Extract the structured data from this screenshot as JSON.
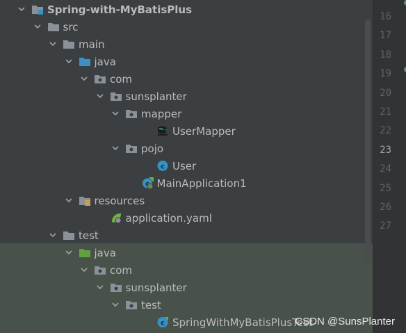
{
  "tree": [
    {
      "label": "Spring-with-MyBatisPlus",
      "depth": 0,
      "icon": "module-folder-icon",
      "expanded": true,
      "bold": true,
      "name": "project-root"
    },
    {
      "label": "src",
      "depth": 1,
      "icon": "folder-icon",
      "expanded": true,
      "name": "src-folder"
    },
    {
      "label": "main",
      "depth": 2,
      "icon": "folder-icon",
      "expanded": true,
      "name": "main-folder"
    },
    {
      "label": "java",
      "depth": 3,
      "icon": "source-root-folder-icon",
      "expanded": true,
      "name": "main-java-folder"
    },
    {
      "label": "com",
      "depth": 4,
      "icon": "package-icon",
      "expanded": true,
      "name": "com-package"
    },
    {
      "label": "sunsplanter",
      "depth": 5,
      "icon": "package-icon",
      "expanded": true,
      "name": "sunsplanter-package"
    },
    {
      "label": "mapper",
      "depth": 6,
      "icon": "package-icon",
      "expanded": true,
      "name": "mapper-package"
    },
    {
      "label": "UserMapper",
      "depth": 8,
      "icon": "mybatis-mapper-icon",
      "name": "usermapper-file"
    },
    {
      "label": "pojo",
      "depth": 6,
      "icon": "package-icon",
      "expanded": true,
      "name": "pojo-package"
    },
    {
      "label": "User",
      "depth": 8,
      "icon": "class-icon",
      "name": "user-class-file"
    },
    {
      "label": "MainApplication1",
      "depth": 7,
      "icon": "spring-boot-class-icon",
      "name": "mainapplication-file"
    },
    {
      "label": "resources",
      "depth": 3,
      "icon": "resources-folder-icon",
      "expanded": true,
      "name": "resources-folder"
    },
    {
      "label": "application.yaml",
      "depth": 5,
      "icon": "spring-config-icon",
      "name": "application-yaml-file"
    },
    {
      "label": "test",
      "depth": 2,
      "icon": "folder-icon",
      "expanded": true,
      "name": "test-folder"
    },
    {
      "label": "java",
      "depth": 3,
      "icon": "test-root-folder-icon",
      "expanded": true,
      "name": "test-java-folder"
    },
    {
      "label": "com",
      "depth": 4,
      "icon": "package-icon",
      "expanded": true,
      "name": "test-com-package"
    },
    {
      "label": "sunsplanter",
      "depth": 5,
      "icon": "package-icon",
      "expanded": true,
      "name": "test-sunsplanter-package"
    },
    {
      "label": "test",
      "depth": 6,
      "icon": "package-icon",
      "expanded": true,
      "name": "test-package"
    },
    {
      "label": "SpringWithMyBatisPlusTest",
      "depth": 8,
      "icon": "test-class-icon",
      "name": "test-class-file"
    }
  ],
  "gutter": {
    "line_numbers": [
      "16",
      "17",
      "18",
      "19",
      "20",
      "21",
      "22",
      "23",
      "24",
      "25",
      "26",
      "27"
    ],
    "current_line": "23"
  },
  "watermark": "CSDN @SunsPlanter",
  "colors": {
    "background": "#3c3f41",
    "test_background": "#49524a",
    "folder": "#8a9199",
    "source_root": "#3d8fc4",
    "test_root": "#62a13e",
    "class": "#3592c4"
  }
}
